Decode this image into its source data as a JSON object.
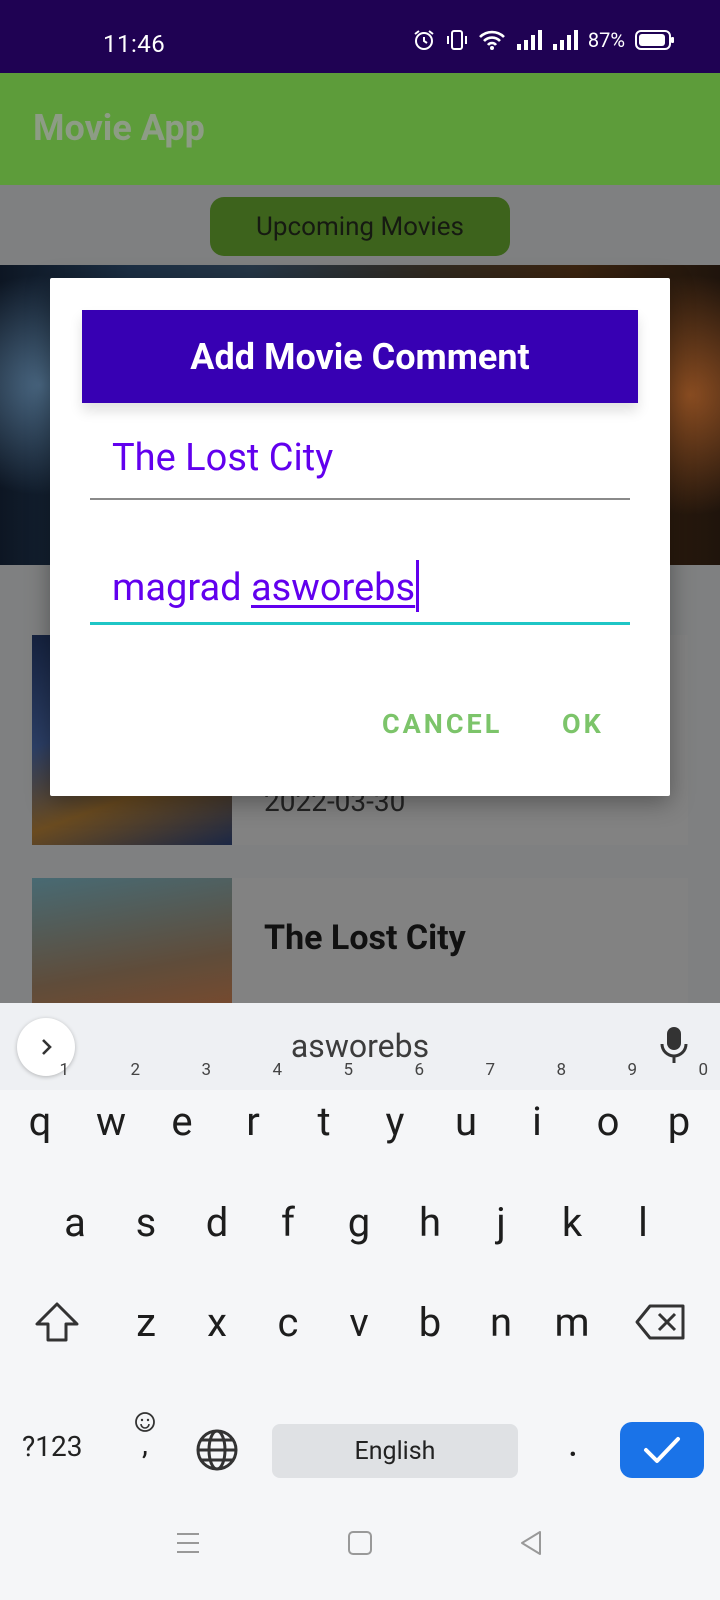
{
  "status_bar": {
    "time": "11:46",
    "battery": "87%"
  },
  "app_bar": {
    "title": "Movie App"
  },
  "upcoming_button": {
    "label": "Upcoming Movies"
  },
  "movie_list": [
    {
      "date": "2022-03-30"
    },
    {
      "title": "The Lost City"
    }
  ],
  "dialog": {
    "title": "Add Movie Comment",
    "movie_field": {
      "value": "The Lost City"
    },
    "comment_field": {
      "value_plain": "magrad ",
      "value_composing": "asworebs"
    },
    "cancel_label": "CANCEL",
    "ok_label": "OK"
  },
  "keyboard": {
    "suggestion": "asworebs",
    "row1": [
      [
        "q",
        "1"
      ],
      [
        "w",
        "2"
      ],
      [
        "e",
        "3"
      ],
      [
        "r",
        "4"
      ],
      [
        "t",
        "5"
      ],
      [
        "y",
        "6"
      ],
      [
        "u",
        "7"
      ],
      [
        "i",
        "8"
      ],
      [
        "o",
        "9"
      ],
      [
        "p",
        "0"
      ]
    ],
    "row2": [
      "a",
      "s",
      "d",
      "f",
      "g",
      "h",
      "j",
      "k",
      "l"
    ],
    "row3": [
      "z",
      "x",
      "c",
      "v",
      "b",
      "n",
      "m"
    ],
    "symbols_label": "?123",
    "comma_label": ",",
    "space_label": "English",
    "period_label": "."
  }
}
